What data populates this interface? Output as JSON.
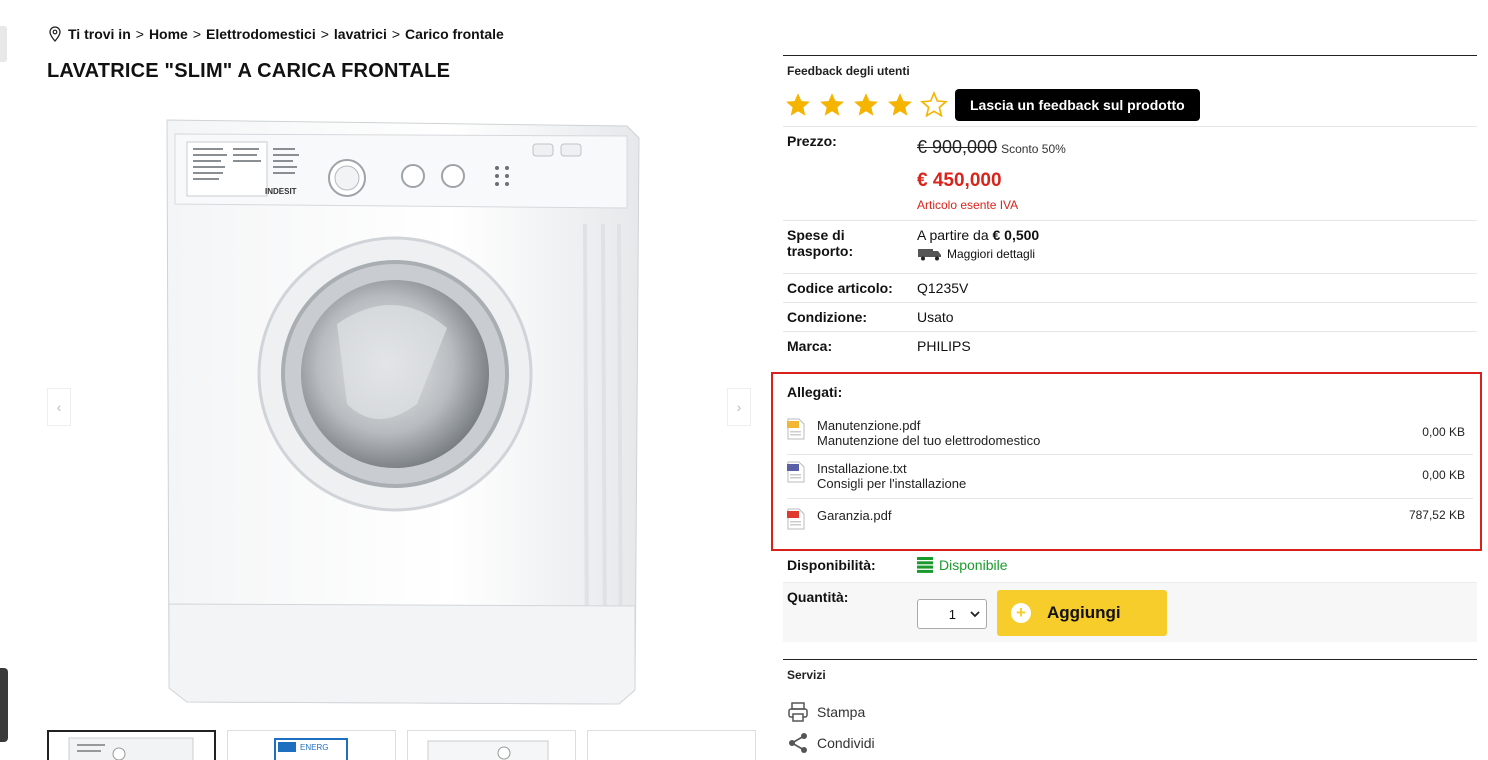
{
  "breadcrumb": {
    "prefix": "Ti trovi in",
    "items": [
      "Home",
      "Elettrodomestici",
      "lavatrici",
      "Carico frontale"
    ],
    "separator": ">"
  },
  "product": {
    "title": "LAVATRICE \"SLIM\" A CARICA FRONTALE",
    "image_brand_text": "INDESIT"
  },
  "gallery": {
    "prev": "‹",
    "next": "›",
    "thumb_count": 4
  },
  "feedback": {
    "heading": "Feedback degli utenti",
    "rating": 4,
    "max_rating": 5,
    "button_label": "Lascia un feedback sul prodotto"
  },
  "price": {
    "label": "Prezzo:",
    "old": "€ 900,000",
    "discount": "Sconto 50%",
    "new": "€ 450,000",
    "note": "Articolo esente IVA"
  },
  "shipping": {
    "label_line1": "Spese di",
    "label_line2": "trasporto:",
    "from_text": "A partire da",
    "amount": "€ 0,500",
    "details_link": "Maggiori dettagli"
  },
  "specs": [
    {
      "label": "Codice articolo:",
      "value": "Q1235V"
    },
    {
      "label": "Condizione:",
      "value": "Usato"
    },
    {
      "label": "Marca:",
      "value": "PHILIPS"
    }
  ],
  "attachments": {
    "label": "Allegati:",
    "files": [
      {
        "name": "Manutenzione.pdf",
        "description": "Manutenzione del tuo elettrodomestico",
        "size": "0,00 KB",
        "type": "ZIP",
        "color": "#f2b632"
      },
      {
        "name": "Installazione.txt",
        "description": "Consigli per l'installazione",
        "size": "0,00 KB",
        "type": "TXT",
        "color": "#5a5fa8"
      },
      {
        "name": "Garanzia.pdf",
        "description": "",
        "size": "787,52 KB",
        "type": "PDF",
        "color": "#e03a2f"
      }
    ]
  },
  "availability": {
    "label": "Disponibilità:",
    "value": "Disponibile"
  },
  "quantity": {
    "label": "Quantità:",
    "value": "1",
    "add_label": "Aggiungi"
  },
  "services": {
    "heading": "Servizi",
    "print": "Stampa",
    "share": "Condividi"
  },
  "colors": {
    "accent_red": "#d9241b",
    "add_yellow": "#f6cd2a",
    "star": "#f5b400",
    "available_green": "#1a9a2c"
  }
}
